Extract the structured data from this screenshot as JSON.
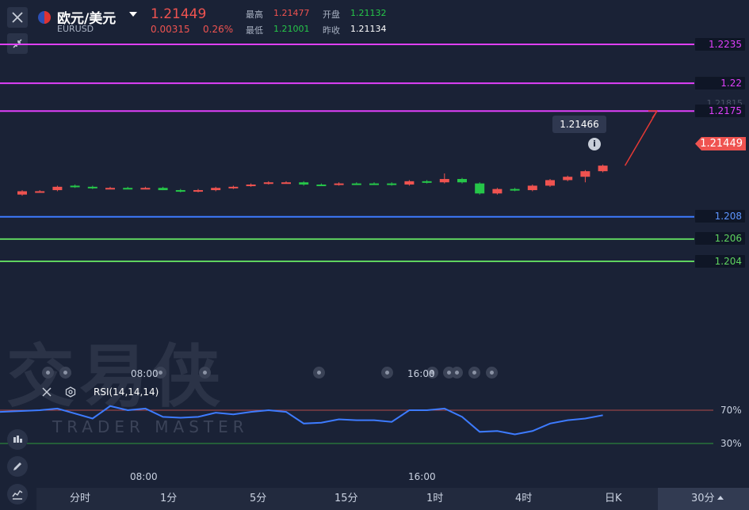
{
  "header": {
    "title": "欧元/美元",
    "symbol": "EURUSD",
    "price": "1.21449",
    "change": "0.00315",
    "change_pct": "0.26%",
    "stats": [
      {
        "label": "最高",
        "value": "1.21477",
        "color": "red"
      },
      {
        "label": "开盘",
        "value": "1.21132",
        "color": "green"
      },
      {
        "label": "最低",
        "value": "1.21001",
        "color": "green"
      },
      {
        "label": "昨收",
        "value": "1.21134",
        "color": "white"
      }
    ]
  },
  "levels": [
    {
      "label": "1.2235",
      "color": "#e040fb",
      "value": 1.2235
    },
    {
      "label": "1.22",
      "color": "#e040fb",
      "value": 1.22
    },
    {
      "label": "1.2175",
      "color": "#e040fb",
      "value": 1.2175
    },
    {
      "label": "1.208",
      "color": "#3d7bff",
      "value": 1.208
    },
    {
      "label": "1.206",
      "color": "#5fd35f",
      "value": 1.206
    },
    {
      "label": "1.204",
      "color": "#5fd35f",
      "value": 1.204
    }
  ],
  "last_price_tag": "1.21449",
  "hover_price": "1.21466",
  "faded_axis_label": "1.21815",
  "time_labels": [
    "08:00",
    "16:00"
  ],
  "rsi": {
    "label": "RSI(14,14,14)",
    "upper": "70%",
    "lower": "30%",
    "upper_value": 70,
    "lower_value": 30,
    "values": [
      68,
      70,
      72,
      66,
      60,
      75,
      70,
      72,
      62,
      61,
      62,
      67,
      65,
      68,
      70,
      68,
      54,
      55,
      59,
      58,
      58,
      56,
      70,
      70,
      72,
      62,
      44,
      45,
      41,
      45,
      54,
      58,
      60,
      64
    ]
  },
  "candles": [
    {
      "o": 1.21,
      "c": 1.2103,
      "h": 1.2104,
      "l": 1.2099,
      "dir": "up"
    },
    {
      "o": 1.2103,
      "c": 1.2103,
      "h": 1.2104,
      "l": 1.2102,
      "dir": "up"
    },
    {
      "o": 1.2104,
      "c": 1.2107,
      "h": 1.2108,
      "l": 1.2103,
      "dir": "up"
    },
    {
      "o": 1.2108,
      "c": 1.2107,
      "h": 1.2109,
      "l": 1.2106,
      "dir": "down"
    },
    {
      "o": 1.2107,
      "c": 1.2106,
      "h": 1.2108,
      "l": 1.2105,
      "dir": "down"
    },
    {
      "o": 1.2106,
      "c": 1.2106,
      "h": 1.2107,
      "l": 1.2105,
      "dir": "up"
    },
    {
      "o": 1.2106,
      "c": 1.2106,
      "h": 1.2107,
      "l": 1.2105,
      "dir": "down"
    },
    {
      "o": 1.2106,
      "c": 1.2106,
      "h": 1.2107,
      "l": 1.2105,
      "dir": "up"
    },
    {
      "o": 1.2106,
      "c": 1.2104,
      "h": 1.2107,
      "l": 1.2104,
      "dir": "down"
    },
    {
      "o": 1.2104,
      "c": 1.2103,
      "h": 1.2105,
      "l": 1.2102,
      "dir": "down"
    },
    {
      "o": 1.2103,
      "c": 1.2104,
      "h": 1.2105,
      "l": 1.2102,
      "dir": "up"
    },
    {
      "o": 1.2104,
      "c": 1.2106,
      "h": 1.2107,
      "l": 1.2103,
      "dir": "up"
    },
    {
      "o": 1.2106,
      "c": 1.2107,
      "h": 1.2108,
      "l": 1.2105,
      "dir": "up"
    },
    {
      "o": 1.2108,
      "c": 1.2109,
      "h": 1.211,
      "l": 1.2107,
      "dir": "up"
    },
    {
      "o": 1.211,
      "c": 1.2111,
      "h": 1.2112,
      "l": 1.2109,
      "dir": "up"
    },
    {
      "o": 1.2111,
      "c": 1.2111,
      "h": 1.2112,
      "l": 1.211,
      "dir": "up"
    },
    {
      "o": 1.2111,
      "c": 1.2109,
      "h": 1.2112,
      "l": 1.2108,
      "dir": "down"
    },
    {
      "o": 1.2109,
      "c": 1.2109,
      "h": 1.211,
      "l": 1.2108,
      "dir": "down"
    },
    {
      "o": 1.2109,
      "c": 1.211,
      "h": 1.2111,
      "l": 1.2108,
      "dir": "up"
    },
    {
      "o": 1.211,
      "c": 1.211,
      "h": 1.2111,
      "l": 1.2109,
      "dir": "down"
    },
    {
      "o": 1.211,
      "c": 1.211,
      "h": 1.2111,
      "l": 1.2109,
      "dir": "down"
    },
    {
      "o": 1.211,
      "c": 1.2109,
      "h": 1.2111,
      "l": 1.2108,
      "dir": "down"
    },
    {
      "o": 1.2109,
      "c": 1.2112,
      "h": 1.2113,
      "l": 1.2108,
      "dir": "up"
    },
    {
      "o": 1.2112,
      "c": 1.2112,
      "h": 1.2113,
      "l": 1.211,
      "dir": "down"
    },
    {
      "o": 1.2111,
      "c": 1.2114,
      "h": 1.2119,
      "l": 1.211,
      "dir": "up"
    },
    {
      "o": 1.2114,
      "c": 1.2111,
      "h": 1.2115,
      "l": 1.211,
      "dir": "down"
    },
    {
      "o": 1.211,
      "c": 1.2101,
      "h": 1.2111,
      "l": 1.21,
      "dir": "down"
    },
    {
      "o": 1.2101,
      "c": 1.2105,
      "h": 1.2106,
      "l": 1.21,
      "dir": "up"
    },
    {
      "o": 1.2105,
      "c": 1.2104,
      "h": 1.2106,
      "l": 1.2103,
      "dir": "down"
    },
    {
      "o": 1.2104,
      "c": 1.2108,
      "h": 1.2109,
      "l": 1.2103,
      "dir": "up"
    },
    {
      "o": 1.2108,
      "c": 1.2113,
      "h": 1.2114,
      "l": 1.2107,
      "dir": "up"
    },
    {
      "o": 1.2113,
      "c": 1.2116,
      "h": 1.2117,
      "l": 1.2112,
      "dir": "up"
    },
    {
      "o": 1.2116,
      "c": 1.2121,
      "h": 1.2122,
      "l": 1.2111,
      "dir": "up"
    },
    {
      "o": 1.2121,
      "c": 1.2126,
      "h": 1.2127,
      "l": 1.212,
      "dir": "up"
    }
  ],
  "tabs": [
    "分时",
    "1分",
    "5分",
    "15分",
    "1时",
    "4时",
    "日K",
    "30分"
  ],
  "watermark": {
    "main": "交易侠",
    "sub": "TRADER MASTER"
  },
  "icons": {
    "close": "close-icon",
    "shrink": "shrink-icon",
    "flag": "flag-icon",
    "caret": "caret-down-icon"
  }
}
